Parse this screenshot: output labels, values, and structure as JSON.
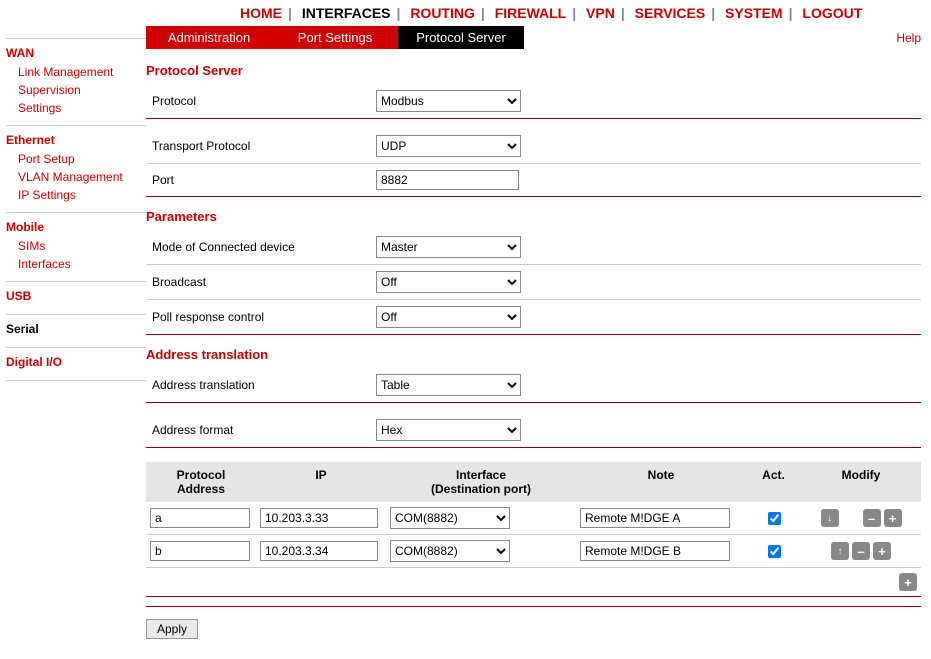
{
  "topnav": {
    "items": [
      "HOME",
      "INTERFACES",
      "ROUTING",
      "FIREWALL",
      "VPN",
      "SERVICES",
      "SYSTEM",
      "LOGOUT"
    ],
    "active": "INTERFACES"
  },
  "sidebar": {
    "wan": {
      "head": "WAN",
      "items": [
        "Link Management",
        "Supervision",
        "Settings"
      ]
    },
    "eth": {
      "head": "Ethernet",
      "items": [
        "Port Setup",
        "VLAN Management",
        "IP Settings"
      ]
    },
    "mob": {
      "head": "Mobile",
      "items": [
        "SIMs",
        "Interfaces"
      ]
    },
    "usb": {
      "head": "USB"
    },
    "serial": {
      "head": "Serial"
    },
    "dio": {
      "head": "Digital I/O"
    }
  },
  "subtabs": {
    "items": [
      "Administration",
      "Port Settings",
      "Protocol Server"
    ],
    "active": "Protocol Server",
    "help": "Help"
  },
  "sections": {
    "protocol_server": {
      "title": "Protocol Server",
      "protocol": {
        "label": "Protocol",
        "value": "Modbus"
      },
      "transport": {
        "label": "Transport Protocol",
        "value": "UDP"
      },
      "port": {
        "label": "Port",
        "value": "8882"
      }
    },
    "parameters": {
      "title": "Parameters",
      "mode": {
        "label": "Mode of Connected device",
        "value": "Master"
      },
      "broadcast": {
        "label": "Broadcast",
        "value": "Off"
      },
      "poll": {
        "label": "Poll response control",
        "value": "Off"
      }
    },
    "addrtrans": {
      "title": "Address translation",
      "trans": {
        "label": "Address translation",
        "value": "Table"
      },
      "format": {
        "label": "Address format",
        "value": "Hex"
      }
    }
  },
  "table": {
    "headers": {
      "addr_l1": "Protocol",
      "addr_l2": "Address",
      "ip": "IP",
      "if_l1": "Interface",
      "if_l2": "(Destination port)",
      "note": "Note",
      "act": "Act.",
      "mod": "Modify"
    },
    "rows": [
      {
        "addr": "a",
        "ip": "10.203.3.33",
        "iface": "COM(8882)",
        "note": "Remote M!DGE A",
        "active": true
      },
      {
        "addr": "b",
        "ip": "10.203.3.34",
        "iface": "COM(8882)",
        "note": "Remote M!DGE B",
        "active": true
      }
    ]
  },
  "apply_label": "Apply"
}
